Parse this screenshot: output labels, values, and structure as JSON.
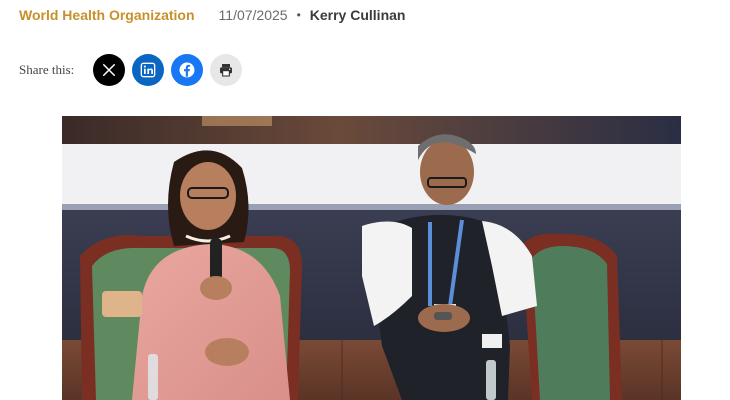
{
  "article_meta": {
    "category": "World Health Organization",
    "date": "11/07/2025",
    "separator": "•",
    "author": "Kerry Cullinan"
  },
  "share": {
    "label": "Share this:",
    "buttons": [
      {
        "icon": "x-icon",
        "color": "#000000"
      },
      {
        "icon": "linkedin-icon",
        "color": "#0a66c2"
      },
      {
        "icon": "facebook-icon",
        "color": "#1877f2"
      },
      {
        "icon": "print-icon",
        "color": "#e7e7e7"
      }
    ]
  },
  "colors": {
    "category": "#c8902a",
    "date": "#6b6b6b",
    "author": "#3a3a3a"
  }
}
